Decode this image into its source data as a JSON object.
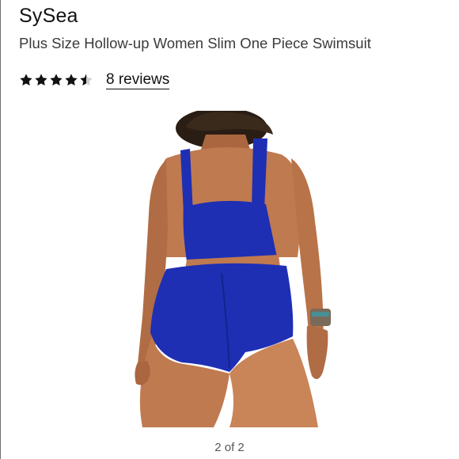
{
  "product": {
    "brand": "SySea",
    "title": "Plus Size Hollow-up Women Slim One Piece Swimsuit"
  },
  "rating": {
    "stars": 4.5,
    "max_stars": 5,
    "reviews_label": "8 reviews"
  },
  "gallery": {
    "counter": "2 of 2",
    "image_icon": "swimsuit-photo"
  },
  "colors": {
    "text": "#111111",
    "subtitle": "#3a3a3a",
    "swimsuit_blue": "#1e2fb4",
    "skin": "#c07a4f"
  }
}
